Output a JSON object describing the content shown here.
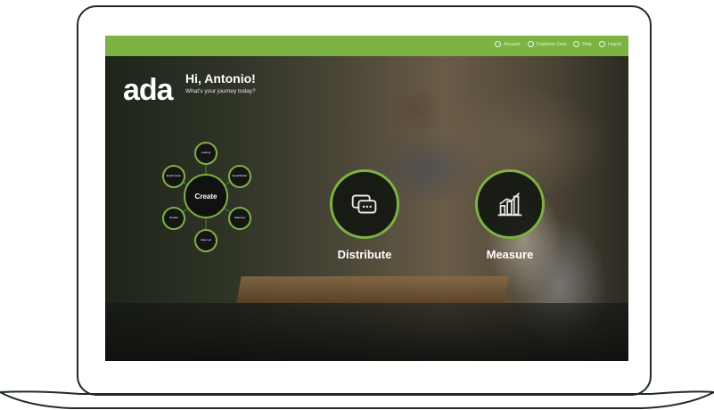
{
  "topnav": {
    "items": [
      {
        "label": "Account",
        "icon": "user-icon"
      },
      {
        "label": "Customer Care",
        "icon": "chat-icon"
      },
      {
        "label": "Help",
        "icon": "help-icon"
      },
      {
        "label": "Logout",
        "icon": "logout-icon"
      }
    ]
  },
  "logo": "ada",
  "greeting": {
    "title": "Hi, Antonio!",
    "subtitle": "What's your journey today?"
  },
  "create": {
    "label": "Create",
    "items": [
      "Landing",
      "Email Builder",
      "Email Center",
      "Stationery",
      "Booklet",
      "Cake tool"
    ]
  },
  "distribute": {
    "label": "Distribute",
    "icon": "distribute-icon"
  },
  "measure": {
    "label": "Measure",
    "icon": "chart-icon"
  },
  "colors": {
    "accent": "#7cb342",
    "dark": "#111111"
  }
}
